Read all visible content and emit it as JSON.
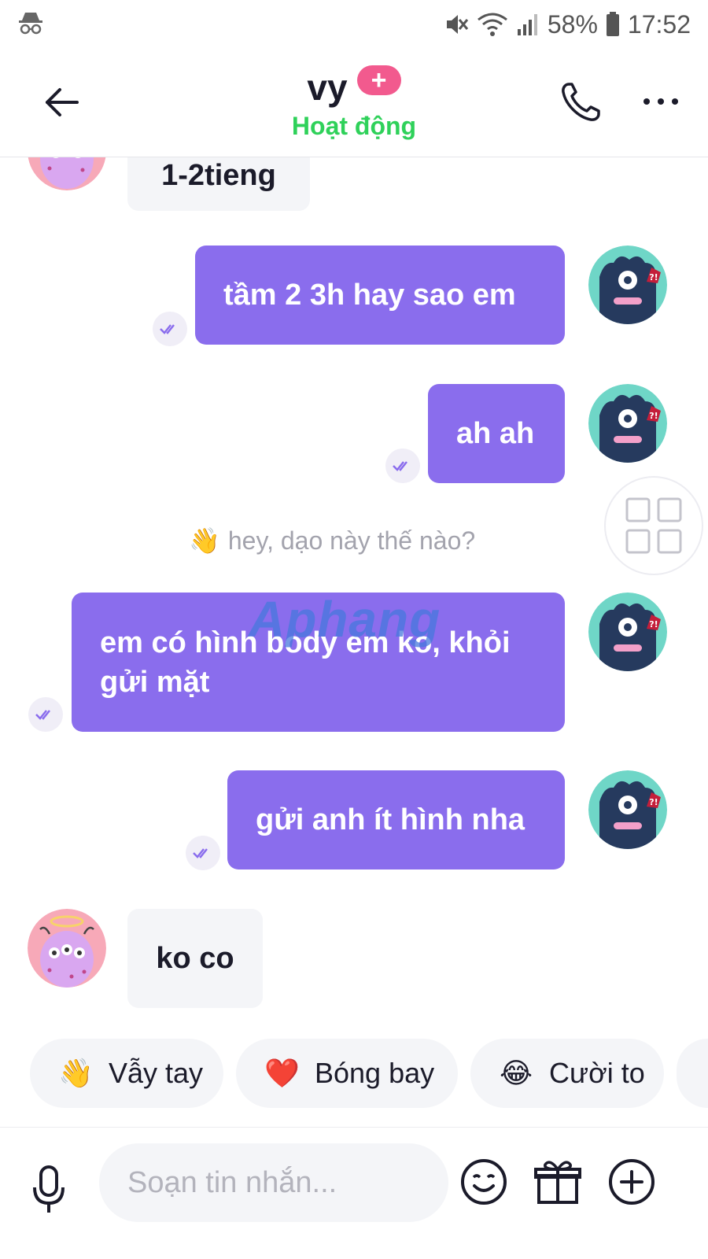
{
  "status_bar": {
    "battery": "58%",
    "time": "17:52"
  },
  "header": {
    "contact_name": "vy",
    "plus_badge": "+",
    "status": "Hoạt động"
  },
  "messages": [
    {
      "direction": "incoming",
      "text": "1-2tieng"
    },
    {
      "direction": "outgoing",
      "text": "tầm 2 3h hay sao em"
    },
    {
      "direction": "outgoing",
      "text": "ah ah"
    },
    {
      "direction": "outgoing",
      "text": "em có hình body em ko, khỏi gửi mặt"
    },
    {
      "direction": "outgoing",
      "text": "gửi anh ít hình nha"
    },
    {
      "direction": "incoming",
      "text": "ko co"
    }
  ],
  "system_message": {
    "emoji": "👋",
    "text": "hey, dạo này thế nào?"
  },
  "watermark": "Aphang",
  "quick_reactions": [
    {
      "emoji": "👋",
      "label": "Vẫy tay"
    },
    {
      "emoji": "❤️",
      "label": "Bóng bay"
    },
    {
      "emoji": "😂",
      "label": "Cười to"
    }
  ],
  "input": {
    "placeholder": "Soạn tin nhắn...",
    "value": ""
  },
  "icons": {
    "back": "arrow-left-icon",
    "call": "phone-icon",
    "more": "more-dots-icon",
    "mic": "microphone-icon",
    "emoji": "smiley-icon",
    "gift": "gift-icon",
    "add": "plus-circle-icon",
    "grid": "grid-icon",
    "read": "double-check-icon"
  },
  "colors": {
    "accent_purple": "#8a6ded",
    "online_green": "#2fd15a",
    "badge_pink": "#f25a8e"
  }
}
